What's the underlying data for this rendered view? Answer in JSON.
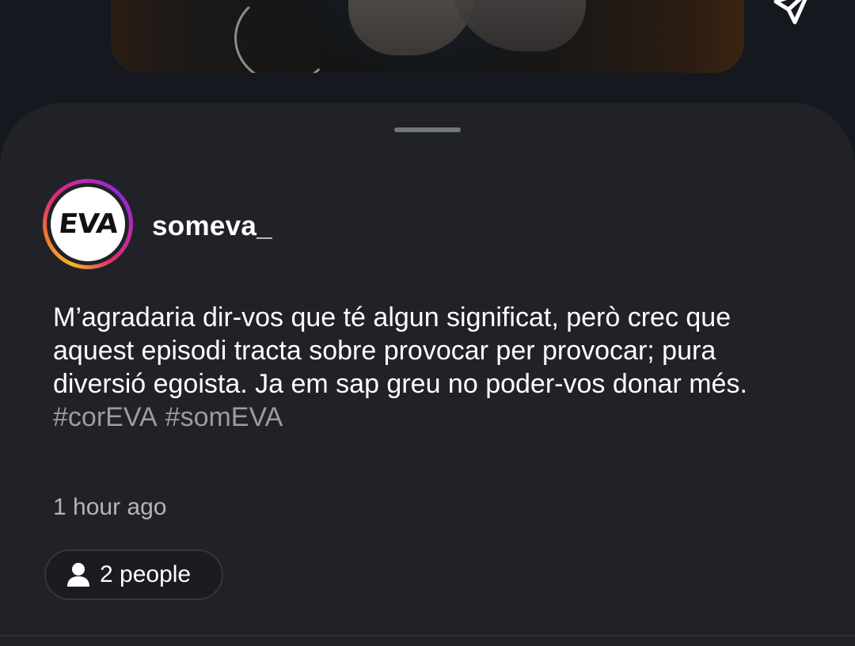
{
  "video_preview": {
    "share_icon": "send-icon"
  },
  "sheet": {
    "grabber": "drag-handle"
  },
  "post": {
    "avatar_text": "EVA",
    "username": "someva_",
    "caption": "M’agradaria dir-vos que té algun significat, però crec que aquest episodi tracta sobre provocar per provocar; pura diversió egoista. Ja em sap greu no poder-vos donar més.",
    "hashtags": [
      "#corEVA",
      "#somEVA"
    ],
    "timestamp": "1 hour ago"
  },
  "people_chip": {
    "icon": "person-icon",
    "label": "2 people"
  }
}
